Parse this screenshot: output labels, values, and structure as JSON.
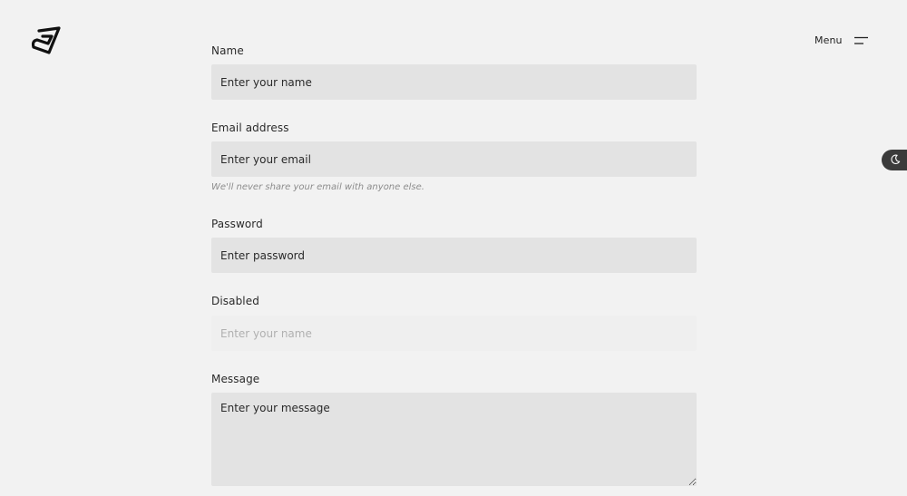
{
  "header": {
    "logo_icon": "brand-logo-icon",
    "menu_label": "Menu",
    "menu_icon": "hamburger-menu-icon"
  },
  "theme_toggle": {
    "icon": "moon-icon"
  },
  "form": {
    "name": {
      "label": "Name",
      "placeholder": "Enter your name",
      "value": ""
    },
    "email": {
      "label": "Email address",
      "placeholder": "Enter your email",
      "value": "",
      "help": "We'll never share your email with anyone else."
    },
    "password": {
      "label": "Password",
      "placeholder": "Enter password",
      "value": ""
    },
    "disabled": {
      "label": "Disabled",
      "placeholder": "Enter your name",
      "value": ""
    },
    "message": {
      "label": "Message",
      "placeholder": "Enter your message",
      "value": ""
    }
  },
  "colors": {
    "page_background": "#f2f2f2",
    "input_background": "#e3e3e3",
    "disabled_background": "#efefef",
    "toggle_background": "#3b3b3b"
  }
}
